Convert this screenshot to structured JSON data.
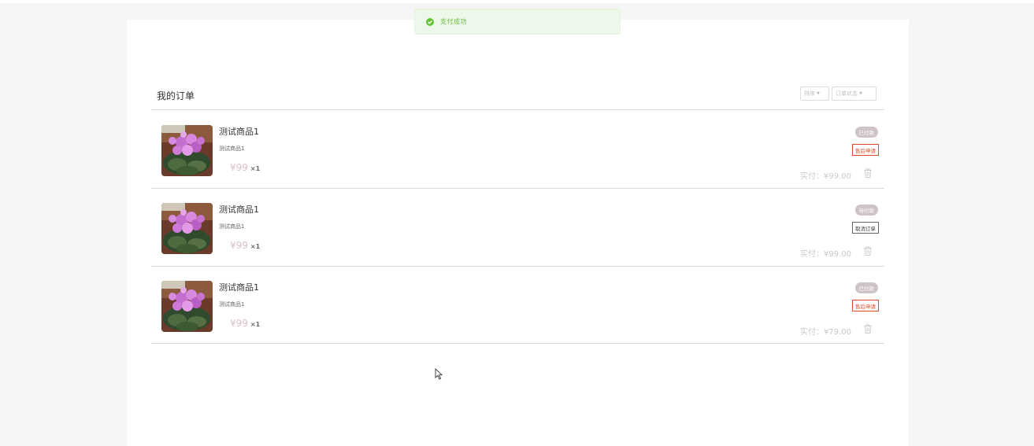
{
  "toast": {
    "message": "支付成功",
    "status_color": "#67c23a"
  },
  "header": {
    "title": "我的订单",
    "sort_dropdown": "排序",
    "status_dropdown": "订单状态"
  },
  "orders": [
    {
      "name": "测试商品1",
      "desc": "测试商品1",
      "price": "¥99",
      "qty": "×1",
      "status": "已付款",
      "action": "售后申请",
      "paid": "实付：¥99.00"
    },
    {
      "name": "测试商品1",
      "desc": "测试商品1",
      "price": "¥99",
      "qty": "×1",
      "status": "待付款",
      "action": "取消订单",
      "paid": "实付：¥99.00"
    },
    {
      "name": "测试商品1",
      "desc": "测试商品1",
      "price": "¥99",
      "qty": "×1",
      "status": "已付款",
      "action": "售后申请",
      "paid": "实付：¥79.00"
    }
  ],
  "icons": {
    "success": "check-circle-icon",
    "delete": "trash-icon",
    "dropdown": "caret-down-icon"
  },
  "colors": {
    "accent_red": "#e04a2a",
    "badge_bg": "#cfc3c6",
    "price": "#d9c0c4"
  }
}
